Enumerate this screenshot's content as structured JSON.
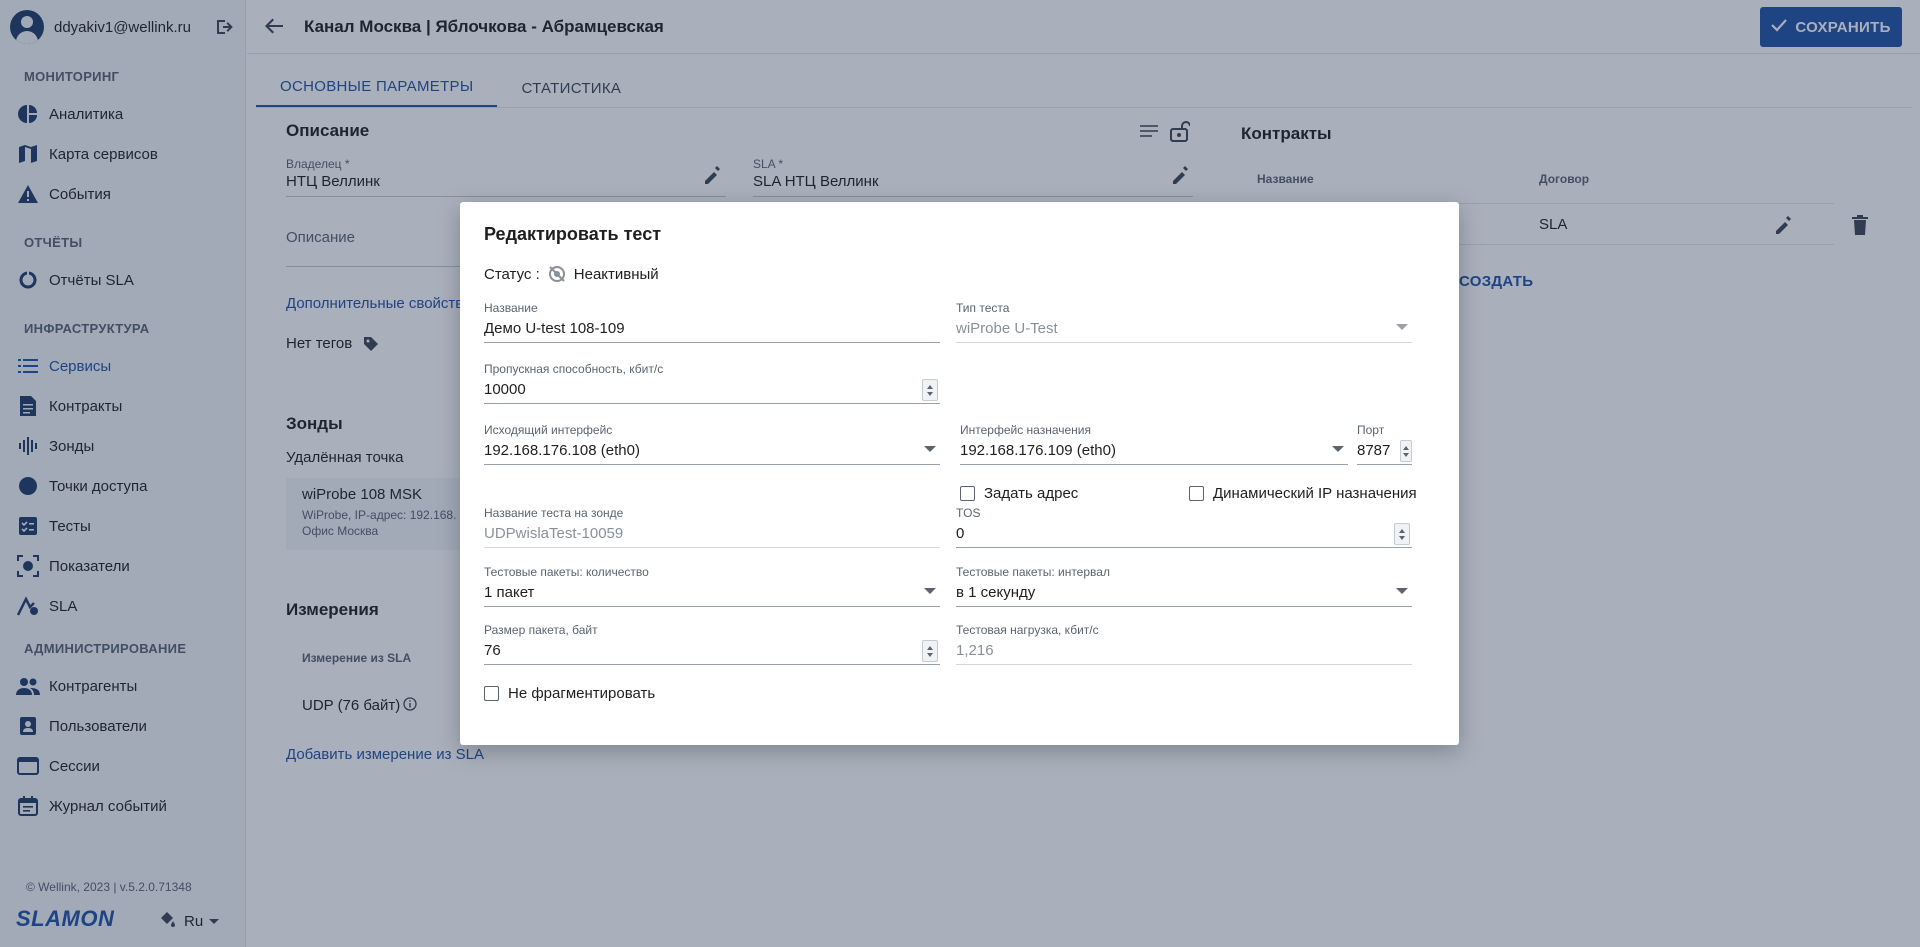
{
  "user": {
    "email": "ddyakiv1@wellink.ru"
  },
  "nav": {
    "sections": [
      "МОНИТОРИНГ",
      "ОТЧЁТЫ",
      "ИНФРАСТРУКТУРА",
      "АДМИНИСТРИРОВАНИЕ"
    ],
    "items": [
      {
        "label": "Аналитика",
        "icon": "pie-chart-icon"
      },
      {
        "label": "Карта сервисов",
        "icon": "map-icon"
      },
      {
        "label": "События",
        "icon": "warning-icon"
      },
      {
        "label": "Отчёты SLA",
        "icon": "sla-report-icon"
      },
      {
        "label": "Сервисы",
        "icon": "list-icon",
        "active": true
      },
      {
        "label": "Контракты",
        "icon": "document-icon"
      },
      {
        "label": "Зонды",
        "icon": "equalizer-icon"
      },
      {
        "label": "Точки доступа",
        "icon": "dot-icon"
      },
      {
        "label": "Тесты",
        "icon": "checklist-icon"
      },
      {
        "label": "Показатели",
        "icon": "metrics-icon"
      },
      {
        "label": "SLA",
        "icon": "sla-icon"
      },
      {
        "label": "Контрагенты",
        "icon": "people-icon"
      },
      {
        "label": "Пользователи",
        "icon": "person-card-icon"
      },
      {
        "label": "Сессии",
        "icon": "window-icon"
      },
      {
        "label": "Журнал событий",
        "icon": "calendar-icon"
      }
    ],
    "active_color": "#2151a3"
  },
  "footer": {
    "copyright": "© Wellink, 2023 | v.5.2.0.71348",
    "logo": "SLAMON",
    "lang": "Ru"
  },
  "page": {
    "title": "Канал Москва | Яблочкова - Абрамцевская",
    "save_label": "СОХРАНИТЬ",
    "tabs": [
      "ОСНОВНЫЕ ПАРАМЕТРЫ",
      "СТАТИСТИКА"
    ]
  },
  "description": {
    "title": "Описание",
    "owner_label": "Владелец *",
    "owner_value": "НТЦ Веллинк",
    "sla_label": "SLA *",
    "sla_value": "SLA НТЦ Веллинк",
    "desc_placeholder": "Описание",
    "extra_link": "Дополнительные свойства",
    "no_tags": "Нет тегов"
  },
  "contracts": {
    "title": "Контракты",
    "col_name": "Название",
    "col_contract": "Договор",
    "row_contract": "SLA",
    "create_link": "СОЗДАТЬ"
  },
  "probes": {
    "title": "Зонды",
    "remote_label": "Удалённая точка",
    "probe_name": "wiProbe 108 MSK",
    "probe_sub": "WiProbe, IP-адрес: 192.168.",
    "probe_office": "Офис Москва"
  },
  "measurements": {
    "title": "Измерения",
    "col_label": "Измерение из SLA",
    "row_label": "UDP (76 байт)",
    "add_link": "Добавить измерение из SLA"
  },
  "dialog": {
    "title": "Редактировать тест",
    "status_label": "Статус :",
    "status_value": "Неактивный",
    "name": {
      "label": "Название",
      "value": "Демо U-test 108-109"
    },
    "test_type": {
      "label": "Тип теста",
      "value": "wiProbe U-Test"
    },
    "bandwidth": {
      "label": "Пропускная способность, кбит/с",
      "value": "10000"
    },
    "src_iface": {
      "label": "Исходящий интерфейс",
      "value": "192.168.176.108 (eth0)"
    },
    "dst_iface": {
      "label": "Интерфейс назначения",
      "value": "192.168.176.109 (eth0)"
    },
    "port": {
      "label": "Порт",
      "value": "8787"
    },
    "set_address": {
      "label": "Задать адрес",
      "checked": false
    },
    "dynamic_ip": {
      "label": "Динамический IP назначения",
      "checked": false
    },
    "probe_test_name": {
      "label": "Название теста на зонде",
      "value": "UDPwislaTest-10059"
    },
    "tos": {
      "label": "TOS",
      "value": "0"
    },
    "packet_count": {
      "label": "Тестовые пакеты: количество",
      "value": "1 пакет"
    },
    "packet_interval": {
      "label": "Тестовые пакеты: интервал",
      "value": "в 1 секунду"
    },
    "packet_size": {
      "label": "Размер пакета, байт",
      "value": "76"
    },
    "test_load": {
      "label": "Тестовая нагрузка, кбит/с",
      "value": "1,216"
    },
    "no_fragment": {
      "label": "Не фрагментировать",
      "checked": false
    }
  }
}
